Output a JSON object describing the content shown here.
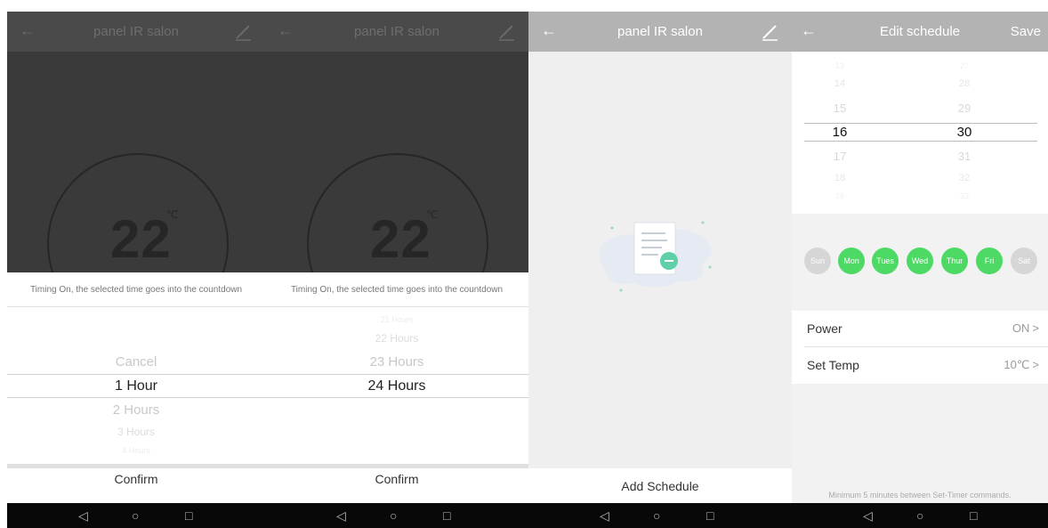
{
  "screens": [
    {
      "header": {
        "title": "panel IR salon"
      },
      "temperature": {
        "value": "22",
        "unit": "℃"
      },
      "sheet": {
        "hint": "Timing On, the selected time goes into the countdown",
        "picker": {
          "above": [
            "Cancel"
          ],
          "selected": "1 Hour",
          "below": [
            "2 Hours",
            "3 Hours",
            "4 Hours"
          ]
        },
        "confirm_label": "Confirm"
      }
    },
    {
      "header": {
        "title": "panel IR salon"
      },
      "temperature": {
        "value": "22",
        "unit": "℃"
      },
      "sheet": {
        "hint": "Timing On, the selected time goes into the countdown",
        "picker": {
          "above": [
            "21 Hours",
            "22 Hours",
            "23 Hours"
          ],
          "selected": "24 Hours",
          "below": []
        },
        "confirm_label": "Confirm"
      }
    },
    {
      "header": {
        "title": "panel IR salon"
      },
      "add_schedule_label": "Add Schedule"
    },
    {
      "header": {
        "title": "Edit schedule",
        "save_label": "Save"
      },
      "time_picker": {
        "hours": [
          "13",
          "14",
          "15",
          "16",
          "17",
          "18",
          "19"
        ],
        "minutes": [
          "27",
          "28",
          "29",
          "30",
          "31",
          "32",
          "33"
        ],
        "selected_hour": "16",
        "selected_minute": "30"
      },
      "days": [
        {
          "label": "Sun",
          "active": false
        },
        {
          "label": "Mon",
          "active": true
        },
        {
          "label": "Tues",
          "active": true
        },
        {
          "label": "Wed",
          "active": true
        },
        {
          "label": "Thur",
          "active": true
        },
        {
          "label": "Fri",
          "active": true
        },
        {
          "label": "Sat",
          "active": false
        }
      ],
      "settings": [
        {
          "label": "Power",
          "value": "ON"
        },
        {
          "label": "Set Temp",
          "value": "10℃"
        }
      ],
      "note": "Minimum 5 minutes between Set-Timer commands."
    }
  ],
  "system_nav": {
    "back": "◁",
    "home": "○",
    "recent": "□"
  },
  "colors": {
    "accent": "#4cd964",
    "header": "#b3b3b3",
    "overlay": "#3a3a3a"
  }
}
